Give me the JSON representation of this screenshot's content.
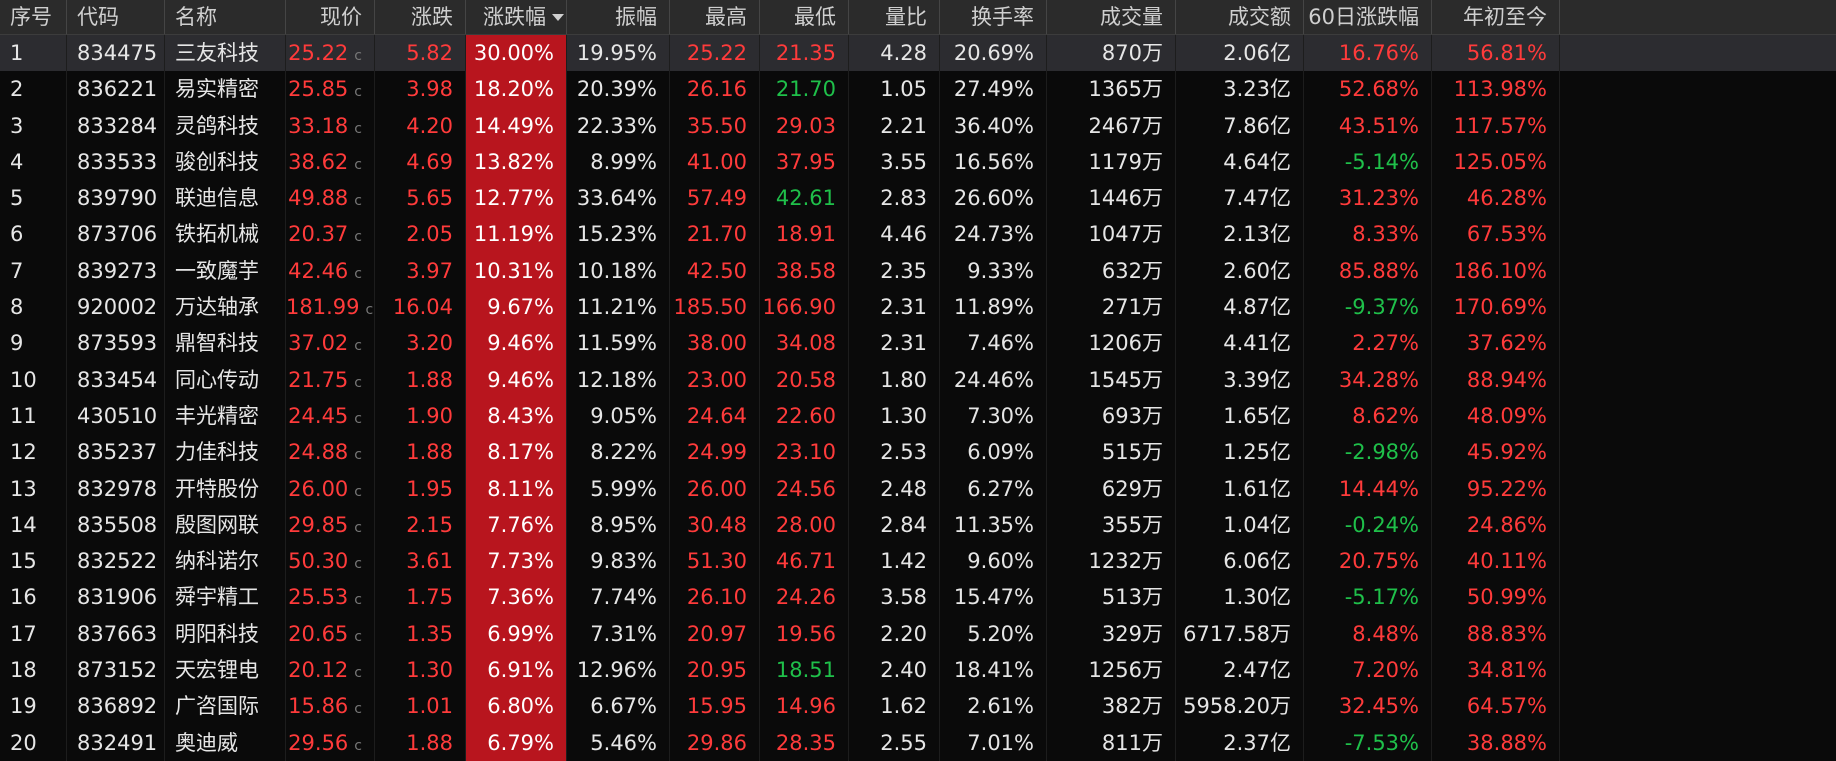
{
  "colors": {
    "up": "#ff3b3b",
    "down": "#1fc04a",
    "highlight": "#b8151e"
  },
  "columns": [
    {
      "key": "seq",
      "label": "序号"
    },
    {
      "key": "code",
      "label": "代码"
    },
    {
      "key": "name",
      "label": "名称"
    },
    {
      "key": "price",
      "label": "现价"
    },
    {
      "key": "change",
      "label": "涨跌"
    },
    {
      "key": "pct",
      "label": "涨跌幅"
    },
    {
      "key": "amp",
      "label": "振幅"
    },
    {
      "key": "high",
      "label": "最高"
    },
    {
      "key": "low",
      "label": "最低"
    },
    {
      "key": "vr",
      "label": "量比"
    },
    {
      "key": "turn",
      "label": "换手率"
    },
    {
      "key": "vol",
      "label": "成交量"
    },
    {
      "key": "amt",
      "label": "成交额"
    },
    {
      "key": "d60",
      "label": "60日涨跌幅"
    },
    {
      "key": "ytd",
      "label": "年初至今"
    }
  ],
  "sort_icon": "sort-descending-icon",
  "price_marker": "c",
  "rows": [
    {
      "seq": "1",
      "code": "834475",
      "name": "三友科技",
      "price": "25.22",
      "change": "5.82",
      "pct": "30.00%",
      "amp": "19.95%",
      "high": "25.22",
      "low": "21.35",
      "low_dir": "up",
      "vr": "4.28",
      "turn": "20.69%",
      "vol": "870万",
      "amt": "2.06亿",
      "d60": "16.76%",
      "d60_dir": "up",
      "ytd": "56.81%",
      "ytd_dir": "up"
    },
    {
      "seq": "2",
      "code": "836221",
      "name": "易实精密",
      "price": "25.85",
      "change": "3.98",
      "pct": "18.20%",
      "amp": "20.39%",
      "high": "26.16",
      "low": "21.70",
      "low_dir": "down",
      "vr": "1.05",
      "turn": "27.49%",
      "vol": "1365万",
      "amt": "3.23亿",
      "d60": "52.68%",
      "d60_dir": "up",
      "ytd": "113.98%",
      "ytd_dir": "up"
    },
    {
      "seq": "3",
      "code": "833284",
      "name": "灵鸽科技",
      "price": "33.18",
      "change": "4.20",
      "pct": "14.49%",
      "amp": "22.33%",
      "high": "35.50",
      "low": "29.03",
      "low_dir": "up",
      "vr": "2.21",
      "turn": "36.40%",
      "vol": "2467万",
      "amt": "7.86亿",
      "d60": "43.51%",
      "d60_dir": "up",
      "ytd": "117.57%",
      "ytd_dir": "up"
    },
    {
      "seq": "4",
      "code": "833533",
      "name": "骏创科技",
      "price": "38.62",
      "change": "4.69",
      "pct": "13.82%",
      "amp": "8.99%",
      "high": "41.00",
      "low": "37.95",
      "low_dir": "up",
      "vr": "3.55",
      "turn": "16.56%",
      "vol": "1179万",
      "amt": "4.64亿",
      "d60": "-5.14%",
      "d60_dir": "down",
      "ytd": "125.05%",
      "ytd_dir": "up"
    },
    {
      "seq": "5",
      "code": "839790",
      "name": "联迪信息",
      "price": "49.88",
      "change": "5.65",
      "pct": "12.77%",
      "amp": "33.64%",
      "high": "57.49",
      "low": "42.61",
      "low_dir": "down",
      "vr": "2.83",
      "turn": "26.60%",
      "vol": "1446万",
      "amt": "7.47亿",
      "d60": "31.23%",
      "d60_dir": "up",
      "ytd": "46.28%",
      "ytd_dir": "up"
    },
    {
      "seq": "6",
      "code": "873706",
      "name": "铁拓机械",
      "price": "20.37",
      "change": "2.05",
      "pct": "11.19%",
      "amp": "15.23%",
      "high": "21.70",
      "low": "18.91",
      "low_dir": "up",
      "vr": "4.46",
      "turn": "24.73%",
      "vol": "1047万",
      "amt": "2.13亿",
      "d60": "8.33%",
      "d60_dir": "up",
      "ytd": "67.53%",
      "ytd_dir": "up"
    },
    {
      "seq": "7",
      "code": "839273",
      "name": "一致魔芋",
      "price": "42.46",
      "change": "3.97",
      "pct": "10.31%",
      "amp": "10.18%",
      "high": "42.50",
      "low": "38.58",
      "low_dir": "up",
      "vr": "2.35",
      "turn": "9.33%",
      "vol": "632万",
      "amt": "2.60亿",
      "d60": "85.88%",
      "d60_dir": "up",
      "ytd": "186.10%",
      "ytd_dir": "up"
    },
    {
      "seq": "8",
      "code": "920002",
      "name": "万达轴承",
      "price": "181.99",
      "change": "16.04",
      "pct": "9.67%",
      "amp": "11.21%",
      "high": "185.50",
      "low": "166.90",
      "low_dir": "up",
      "vr": "2.31",
      "turn": "11.89%",
      "vol": "271万",
      "amt": "4.87亿",
      "d60": "-9.37%",
      "d60_dir": "down",
      "ytd": "170.69%",
      "ytd_dir": "up"
    },
    {
      "seq": "9",
      "code": "873593",
      "name": "鼎智科技",
      "price": "37.02",
      "change": "3.20",
      "pct": "9.46%",
      "amp": "11.59%",
      "high": "38.00",
      "low": "34.08",
      "low_dir": "up",
      "vr": "2.31",
      "turn": "7.46%",
      "vol": "1206万",
      "amt": "4.41亿",
      "d60": "2.27%",
      "d60_dir": "up",
      "ytd": "37.62%",
      "ytd_dir": "up"
    },
    {
      "seq": "10",
      "code": "833454",
      "name": "同心传动",
      "price": "21.75",
      "change": "1.88",
      "pct": "9.46%",
      "amp": "12.18%",
      "high": "23.00",
      "low": "20.58",
      "low_dir": "up",
      "vr": "1.80",
      "turn": "24.46%",
      "vol": "1545万",
      "amt": "3.39亿",
      "d60": "34.28%",
      "d60_dir": "up",
      "ytd": "88.94%",
      "ytd_dir": "up"
    },
    {
      "seq": "11",
      "code": "430510",
      "name": "丰光精密",
      "price": "24.45",
      "change": "1.90",
      "pct": "8.43%",
      "amp": "9.05%",
      "high": "24.64",
      "low": "22.60",
      "low_dir": "up",
      "vr": "1.30",
      "turn": "7.30%",
      "vol": "693万",
      "amt": "1.65亿",
      "d60": "8.62%",
      "d60_dir": "up",
      "ytd": "48.09%",
      "ytd_dir": "up"
    },
    {
      "seq": "12",
      "code": "835237",
      "name": "力佳科技",
      "price": "24.88",
      "change": "1.88",
      "pct": "8.17%",
      "amp": "8.22%",
      "high": "24.99",
      "low": "23.10",
      "low_dir": "up",
      "vr": "2.53",
      "turn": "6.09%",
      "vol": "515万",
      "amt": "1.25亿",
      "d60": "-2.98%",
      "d60_dir": "down",
      "ytd": "45.92%",
      "ytd_dir": "up"
    },
    {
      "seq": "13",
      "code": "832978",
      "name": "开特股份",
      "price": "26.00",
      "change": "1.95",
      "pct": "8.11%",
      "amp": "5.99%",
      "high": "26.00",
      "low": "24.56",
      "low_dir": "up",
      "vr": "2.48",
      "turn": "6.27%",
      "vol": "629万",
      "amt": "1.61亿",
      "d60": "14.44%",
      "d60_dir": "up",
      "ytd": "95.22%",
      "ytd_dir": "up"
    },
    {
      "seq": "14",
      "code": "835508",
      "name": "殷图网联",
      "price": "29.85",
      "change": "2.15",
      "pct": "7.76%",
      "amp": "8.95%",
      "high": "30.48",
      "low": "28.00",
      "low_dir": "up",
      "vr": "2.84",
      "turn": "11.35%",
      "vol": "355万",
      "amt": "1.04亿",
      "d60": "-0.24%",
      "d60_dir": "down",
      "ytd": "24.86%",
      "ytd_dir": "up"
    },
    {
      "seq": "15",
      "code": "832522",
      "name": "纳科诺尔",
      "price": "50.30",
      "change": "3.61",
      "pct": "7.73%",
      "amp": "9.83%",
      "high": "51.30",
      "low": "46.71",
      "low_dir": "up",
      "vr": "1.42",
      "turn": "9.60%",
      "vol": "1232万",
      "amt": "6.06亿",
      "d60": "20.75%",
      "d60_dir": "up",
      "ytd": "40.11%",
      "ytd_dir": "up"
    },
    {
      "seq": "16",
      "code": "831906",
      "name": "舜宇精工",
      "price": "25.53",
      "change": "1.75",
      "pct": "7.36%",
      "amp": "7.74%",
      "high": "26.10",
      "low": "24.26",
      "low_dir": "up",
      "vr": "3.58",
      "turn": "15.47%",
      "vol": "513万",
      "amt": "1.30亿",
      "d60": "-5.17%",
      "d60_dir": "down",
      "ytd": "50.99%",
      "ytd_dir": "up"
    },
    {
      "seq": "17",
      "code": "837663",
      "name": "明阳科技",
      "price": "20.65",
      "change": "1.35",
      "pct": "6.99%",
      "amp": "7.31%",
      "high": "20.97",
      "low": "19.56",
      "low_dir": "up",
      "vr": "2.20",
      "turn": "5.20%",
      "vol": "329万",
      "amt": "6717.58万",
      "d60": "8.48%",
      "d60_dir": "up",
      "ytd": "88.83%",
      "ytd_dir": "up"
    },
    {
      "seq": "18",
      "code": "873152",
      "name": "天宏锂电",
      "price": "20.12",
      "change": "1.30",
      "pct": "6.91%",
      "amp": "12.96%",
      "high": "20.95",
      "low": "18.51",
      "low_dir": "down",
      "vr": "2.40",
      "turn": "18.41%",
      "vol": "1256万",
      "amt": "2.47亿",
      "d60": "7.20%",
      "d60_dir": "up",
      "ytd": "34.81%",
      "ytd_dir": "up"
    },
    {
      "seq": "19",
      "code": "836892",
      "name": "广咨国际",
      "price": "15.86",
      "change": "1.01",
      "pct": "6.80%",
      "amp": "6.67%",
      "high": "15.95",
      "low": "14.96",
      "low_dir": "up",
      "vr": "1.62",
      "turn": "2.61%",
      "vol": "382万",
      "amt": "5958.20万",
      "d60": "32.45%",
      "d60_dir": "up",
      "ytd": "64.57%",
      "ytd_dir": "up"
    },
    {
      "seq": "20",
      "code": "832491",
      "name": "奥迪威",
      "price": "29.56",
      "change": "1.88",
      "pct": "6.79%",
      "amp": "5.46%",
      "high": "29.86",
      "low": "28.35",
      "low_dir": "up",
      "vr": "2.55",
      "turn": "7.01%",
      "vol": "811万",
      "amt": "2.37亿",
      "d60": "-7.53%",
      "d60_dir": "down",
      "ytd": "38.88%",
      "ytd_dir": "up"
    }
  ]
}
